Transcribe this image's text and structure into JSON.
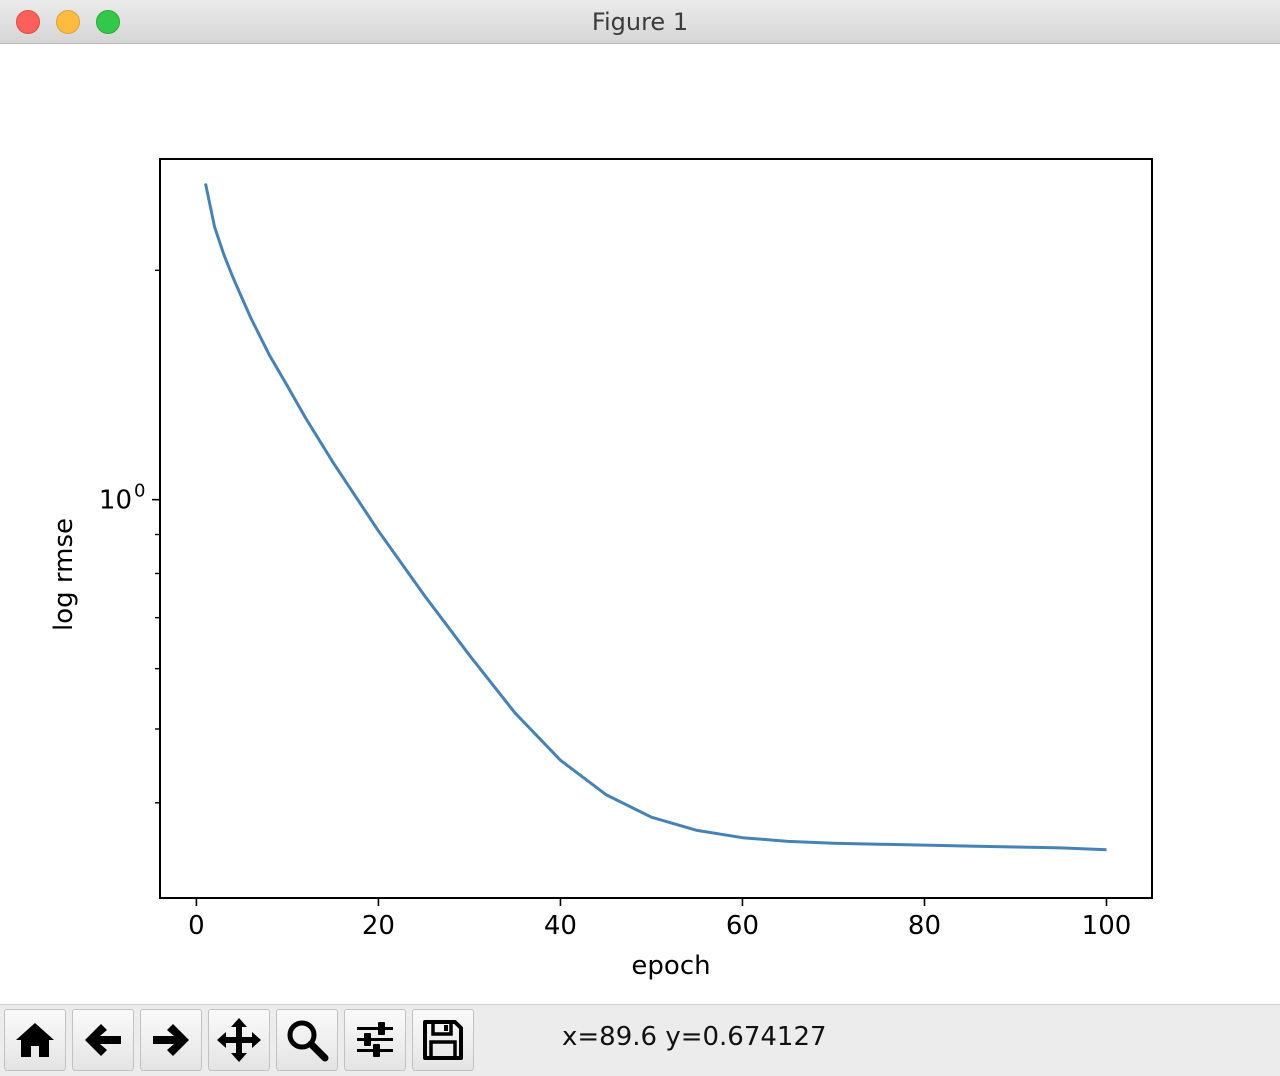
{
  "window": {
    "title": "Figure 1"
  },
  "toolbar": {
    "buttons": [
      {
        "name": "home",
        "icon": "home-icon"
      },
      {
        "name": "back",
        "icon": "arrow-left-icon"
      },
      {
        "name": "forward",
        "icon": "arrow-right-icon"
      },
      {
        "name": "pan",
        "icon": "move-icon"
      },
      {
        "name": "zoom",
        "icon": "magnifier-icon"
      },
      {
        "name": "configure-subplots",
        "icon": "sliders-icon"
      },
      {
        "name": "save",
        "icon": "floppy-disk-icon"
      }
    ],
    "coords": "x=89.6 y=0.674127"
  },
  "chart_data": {
    "type": "line",
    "xlabel": "epoch",
    "ylabel": "log rmse",
    "yscale": "log",
    "xlim": [
      -4,
      105
    ],
    "ylim": [
      0.3,
      2.8
    ],
    "xticks": [
      0,
      20,
      40,
      60,
      80,
      100
    ],
    "yticks_major": [
      1
    ],
    "ytick_labels": [
      {
        "base": "10",
        "exp": "0"
      }
    ],
    "yticks_minor": [
      0.4,
      0.5,
      0.6,
      0.7,
      0.8,
      0.9,
      2
    ],
    "grid": false,
    "line_color": "#4682b4",
    "series": [
      {
        "x": [
          1,
          2,
          3,
          4,
          5,
          6,
          8,
          10,
          12,
          15,
          20,
          25,
          30,
          35,
          40,
          45,
          50,
          55,
          60,
          65,
          70,
          75,
          80,
          85,
          90,
          95,
          100
        ],
        "y": [
          2.6,
          2.28,
          2.1,
          1.96,
          1.84,
          1.73,
          1.55,
          1.41,
          1.28,
          1.12,
          0.91,
          0.75,
          0.625,
          0.525,
          0.455,
          0.41,
          0.383,
          0.368,
          0.36,
          0.356,
          0.354,
          0.353,
          0.352,
          0.351,
          0.35,
          0.349,
          0.347
        ]
      }
    ]
  }
}
